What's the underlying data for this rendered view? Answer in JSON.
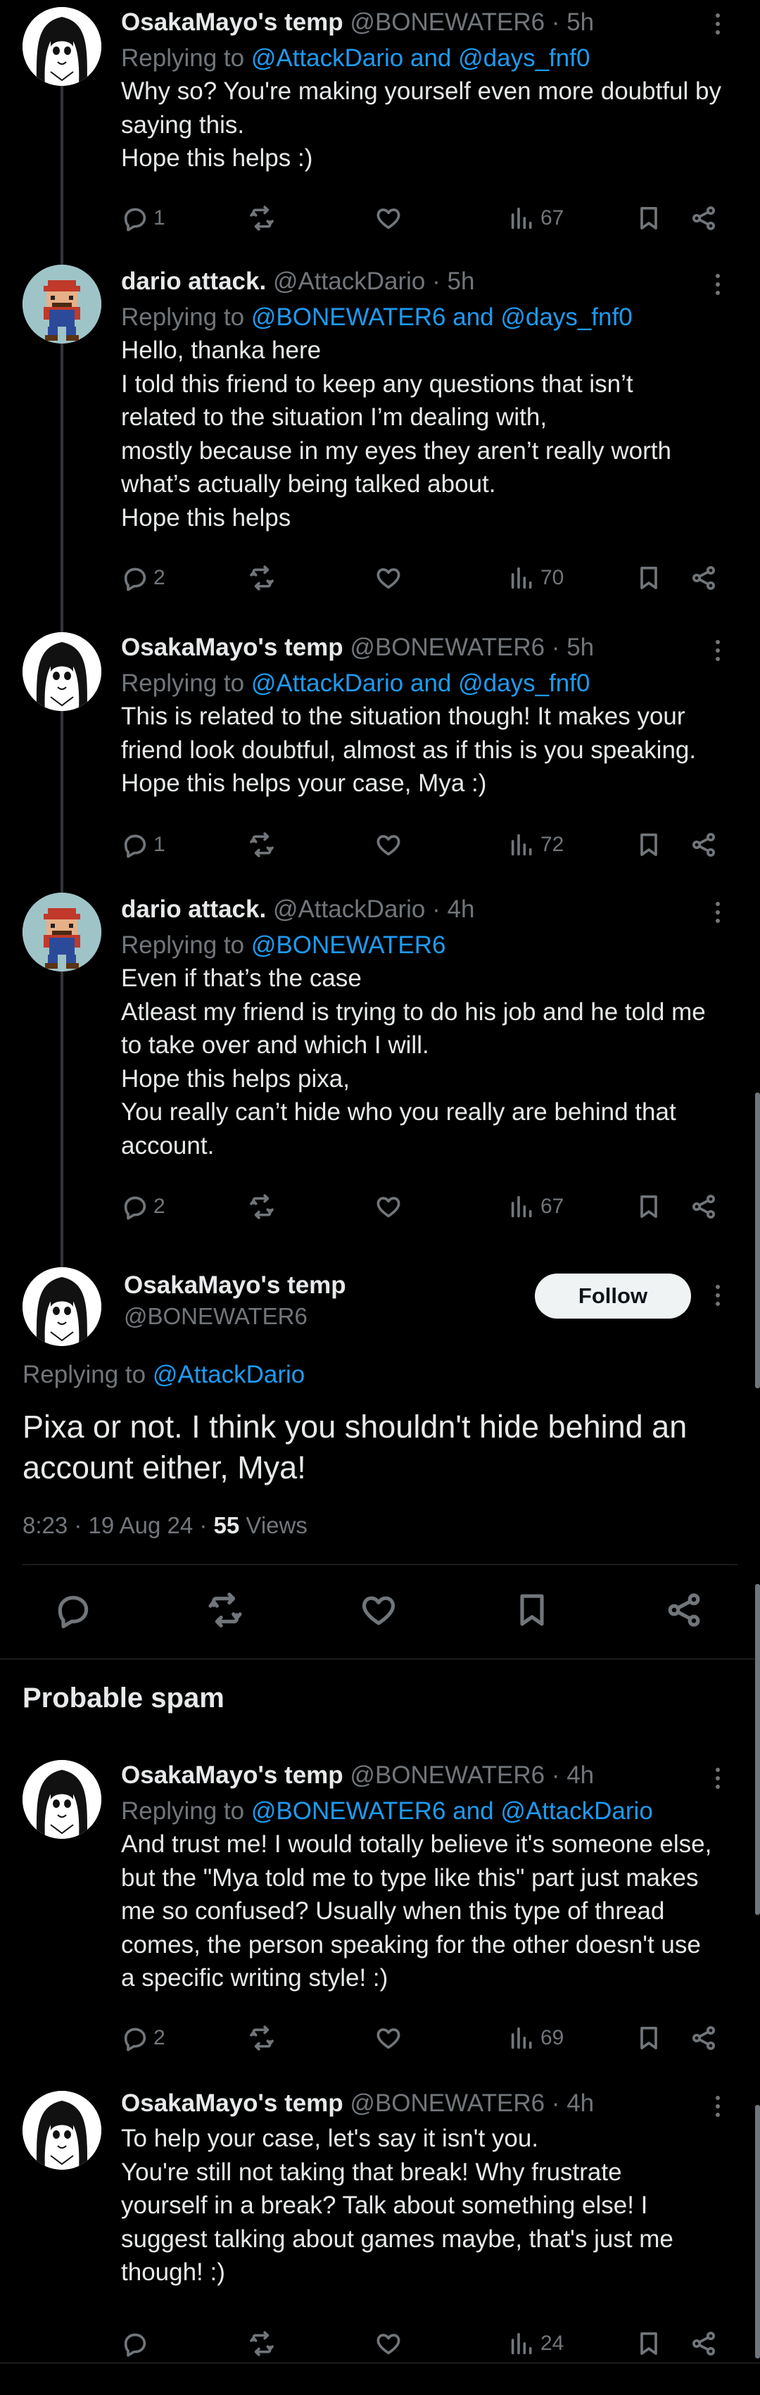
{
  "replies": [
    {
      "name": "OsakaMayo's temp",
      "handle": "@BONEWATER6",
      "time": "5h",
      "replying_prefix": "Replying to",
      "replying_to": "@AttackDario and @days_fnf0",
      "lines": [
        "Why so? You're making yourself even more doubtful by",
        "saying this.",
        "Hope this helps :)"
      ],
      "reply_count": "1",
      "views": "67",
      "avatar": "osaka-avatar"
    },
    {
      "name": "dario attack.",
      "handle": "@AttackDario",
      "time": "5h",
      "replying_prefix": "Replying to",
      "replying_to": "@BONEWATER6 and @days_fnf0",
      "lines": [
        "Hello, thanka here",
        "I told this friend to keep any questions that isn’t",
        "related to the situation I’m dealing with,",
        "mostly because in my eyes they aren’t really worth",
        "what’s actually being talked about.",
        "Hope this helps"
      ],
      "reply_count": "2",
      "views": "70",
      "avatar": "mario-avatar"
    },
    {
      "name": "OsakaMayo's temp",
      "handle": "@BONEWATER6",
      "time": "5h",
      "replying_prefix": "Replying to",
      "replying_to": "@AttackDario and @days_fnf0",
      "lines": [
        "This is related to the situation though! It makes your",
        "friend look doubtful, almost as if this is you speaking.",
        "Hope this helps your case, Mya :)"
      ],
      "reply_count": "1",
      "views": "72",
      "avatar": "osaka-avatar"
    },
    {
      "name": "dario attack.",
      "handle": "@AttackDario",
      "time": "4h",
      "replying_prefix": "Replying to",
      "replying_to": "@BONEWATER6",
      "lines": [
        "Even if that’s the case",
        "Atleast my friend is trying to do his job and he told me",
        "to take over and which I will.",
        "Hope this helps pixa,",
        "You really can’t hide who you really are behind that",
        "account."
      ],
      "reply_count": "2",
      "views": "67",
      "avatar": "mario-avatar"
    }
  ],
  "main_tweet": {
    "name": "OsakaMayo's temp",
    "handle": "@BONEWATER6",
    "follow_label": "Follow",
    "replying_prefix": "Replying to",
    "replying_to": "@AttackDario",
    "lines": [
      "Pixa or not. I think you shouldn't hide behind an",
      "account either, Mya!"
    ],
    "timestamp": "8:23 · 19 Aug 24 · ",
    "views_count": "55",
    "views_label": " Views"
  },
  "spam_section": {
    "title": "Probable spam",
    "replies": [
      {
        "name": "OsakaMayo's temp",
        "handle": "@BONEWATER6",
        "time": "4h",
        "replying_prefix": "Replying to",
        "replying_to": "@BONEWATER6 and @AttackDario",
        "lines": [
          "And trust me! I would totally believe it's someone else,",
          "but the \"Mya told me to type like this\" part just makes",
          "me so confused? Usually when this type of thread",
          "comes, the person speaking for the other doesn't use",
          "a specific writing style! :)"
        ],
        "reply_count": "2",
        "views": "69"
      },
      {
        "name": "OsakaMayo's temp",
        "handle": "@BONEWATER6",
        "time": "4h",
        "lines": [
          "To help your case, let's say it isn't you.",
          "You're still not taking that break! Why frustrate",
          "yourself in a break? Talk about something else! I",
          "suggest talking about games maybe, that's just me",
          "though! :)"
        ],
        "reply_count": "",
        "views": "24"
      }
    ]
  },
  "colors": {
    "background": "#000000",
    "text": "#e7e9ea",
    "secondary": "#71767b",
    "link": "#1d9bf0",
    "divider": "#2f3336"
  },
  "icons": [
    "reply-icon",
    "retweet-icon",
    "like-icon",
    "views-icon",
    "bookmark-icon",
    "share-icon",
    "more-icon"
  ]
}
